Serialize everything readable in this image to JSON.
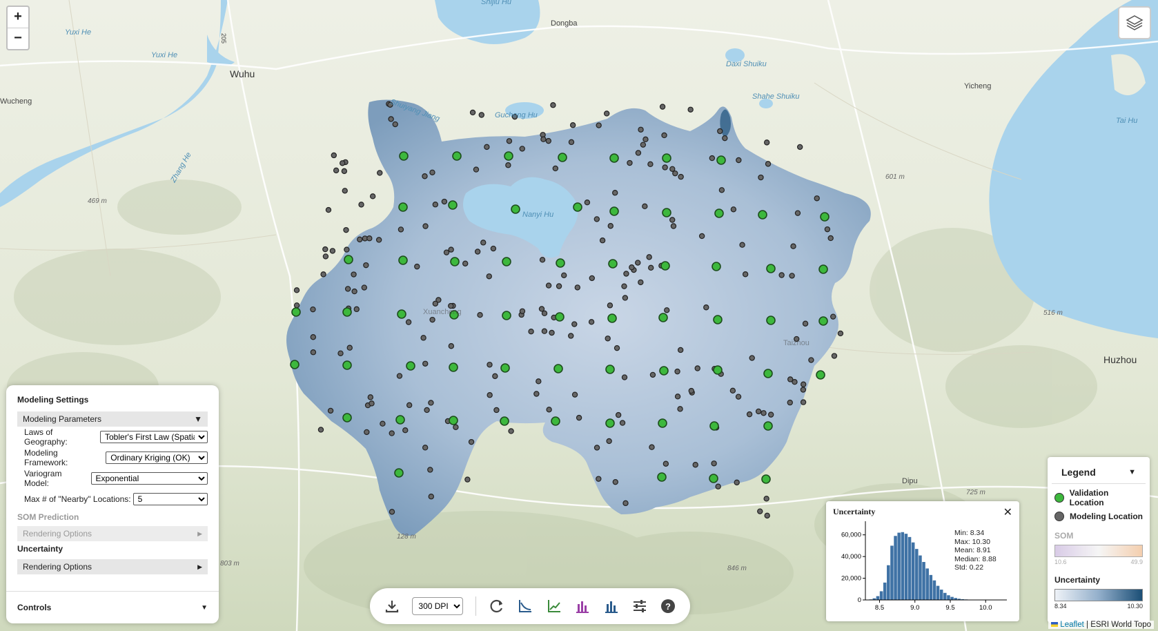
{
  "map": {
    "labels": {
      "shijiu_hu": "Shijiu Hu",
      "dongba": "Dongba",
      "yuxi_he_1": "Yuxi He",
      "yuxi_he_2": "Yuxi He",
      "wuhu": "Wuhu",
      "wucheng": "Wucheng",
      "daxi_shuiku": "Daxi Shuiku",
      "yicheng": "Yicheng",
      "shahe_shuiku": "Shahe Shuiku",
      "tai_hu": "Tai Hu",
      "gucheng_hu": "Gucheng Hu",
      "shuiyang_jiang": "Shuiyang Jiang",
      "zhang_he": "Zhang He",
      "nanyi_hu": "Nanyi Hu",
      "elev_469": "469 m",
      "elev_601": "601 m",
      "elev_516": "516 m",
      "elev_803": "803 m",
      "elev_846": "846 m",
      "elev_725": "725 m",
      "elev_128": "128 m",
      "huzhou": "Huzhou",
      "dipu": "Dipu",
      "xuancheng": "Xuancheng",
      "taizhou": "Taizhou",
      "road_205": "205"
    }
  },
  "zoom": {
    "in": "+",
    "out": "−"
  },
  "layers_icon": "layers-icon",
  "panel": {
    "title": "Modeling Settings",
    "params_section": "Modeling Parameters",
    "params_arrow": "▼",
    "laws_label": "Laws of Geography:",
    "laws_value": "Tobler's First Law (Spatial)",
    "framework_label": "Modeling Framework:",
    "framework_value": "Ordinary Kriging (OK)",
    "variogram_label": "Variogram Model:",
    "variogram_value": "Exponential",
    "nearby_label": "Max # of \"Nearby\" Locations:",
    "nearby_value": "5",
    "som_heading": "SOM Prediction",
    "som_render": "Rendering Options",
    "som_arrow": "▶",
    "unc_heading": "Uncertainty",
    "unc_render": "Rendering Options",
    "unc_arrow": "▶",
    "controls": "Controls",
    "controls_arrow": "▼"
  },
  "toolbar": {
    "dpi": "300 DPI",
    "icons": [
      "download-icon",
      "refresh-icon",
      "scatter-fit-icon",
      "trend-icon",
      "histogram-purple-icon",
      "histogram-blue-icon",
      "sliders-icon",
      "help-icon"
    ]
  },
  "histogram": {
    "title": "Uncertainty",
    "close": "✕",
    "stats": {
      "min": "Min: 8.34",
      "max": "Max: 10.30",
      "mean": "Mean: 8.91",
      "median": "Median: 8.88",
      "std": "Std: 0.22"
    },
    "chart_data": {
      "type": "bar",
      "xlim": [
        8.3,
        10.3
      ],
      "ylim": [
        0,
        70000
      ],
      "yticks": [
        "60,000",
        "40,000",
        "20,000",
        "0"
      ],
      "ytick_values": [
        60000,
        40000,
        20000,
        0
      ],
      "xticks": [
        "8.5",
        "9.0",
        "9.5",
        "10.0"
      ],
      "xtick_values": [
        8.5,
        9.0,
        9.5,
        10.0
      ],
      "bin_width": 0.05,
      "bin_starts": [
        8.35,
        8.4,
        8.45,
        8.5,
        8.55,
        8.6,
        8.65,
        8.7,
        8.75,
        8.8,
        8.85,
        8.9,
        8.95,
        9.0,
        9.05,
        9.1,
        9.15,
        9.2,
        9.25,
        9.3,
        9.35,
        9.4,
        9.45,
        9.5,
        9.55,
        9.6,
        9.65,
        9.7,
        9.75,
        9.8,
        9.85,
        9.9
      ],
      "values": [
        500,
        1500,
        3500,
        8000,
        16000,
        32000,
        50000,
        59000,
        62000,
        62500,
        61000,
        58000,
        53000,
        47000,
        41000,
        35000,
        29000,
        23000,
        18000,
        13000,
        9500,
        6500,
        4300,
        2800,
        1800,
        1100,
        700,
        450,
        300,
        200,
        120,
        80
      ],
      "color": "#3f72a5"
    }
  },
  "legend": {
    "title": "Legend",
    "arrow": "▼",
    "validation": "Validation Location",
    "modeling": "Modeling Location",
    "som_title": "SOM",
    "som_min": "10.6",
    "som_max": "49.9",
    "unc_title": "Uncertainty",
    "unc_min": "8.34",
    "unc_max": "10.30",
    "colors": {
      "validation": "#3db83d",
      "modeling": "#666666"
    }
  },
  "attribution": {
    "leaflet": "Leaflet",
    "rest": "| ESRI World Topo"
  }
}
